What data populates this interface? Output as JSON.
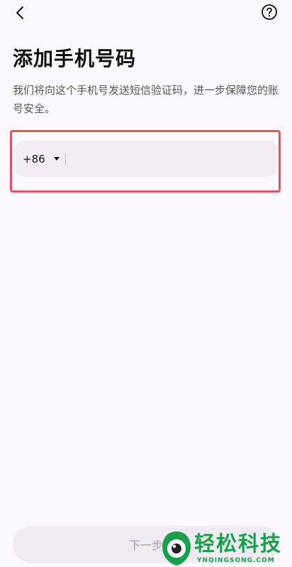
{
  "header": {
    "back_icon": "chevron-left-icon",
    "help_icon": "question-circle-icon"
  },
  "main": {
    "title": "添加手机号码",
    "subtitle": "我们将向这个手机号发送短信验证码，进一步保障您的账号安全。",
    "country_code": "+86",
    "phone_value": "",
    "phone_placeholder": ""
  },
  "footer": {
    "next_label": "下一步"
  },
  "watermark": {
    "name": "轻松科技",
    "url": "YNQINGSONG.COM"
  },
  "colors": {
    "highlight": "#ec4f5a",
    "brand_green": "#19a04a"
  }
}
